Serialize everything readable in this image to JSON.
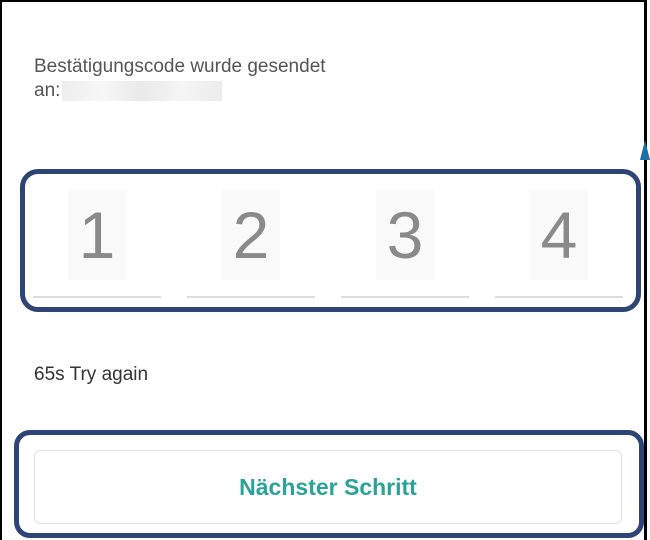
{
  "verification": {
    "message_line1": "Bestätigungscode wurde gesendet",
    "message_line2_prefix": "an:"
  },
  "code": {
    "digits": [
      "1",
      "2",
      "3",
      "4"
    ]
  },
  "resend": {
    "timer_text": "65s Try again"
  },
  "actions": {
    "next_label": "Nächster Schritt"
  },
  "colors": {
    "highlight_border": "#2e4477",
    "button_text": "#2aa39a",
    "digit_text": "#8a8a8a"
  }
}
